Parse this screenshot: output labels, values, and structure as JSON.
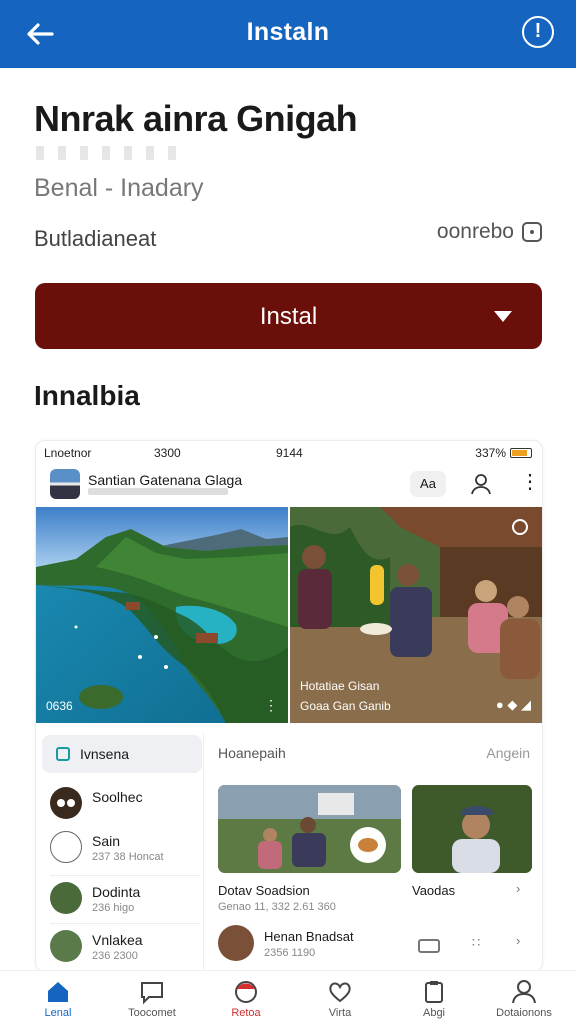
{
  "appbar": {
    "title": "Instaln",
    "back_icon": "back-arrow-icon",
    "info_icon": "info-icon",
    "info_glyph": "!"
  },
  "app": {
    "name": "Nnrak ainra Gnigah",
    "subtitle": "Benal - Inadary",
    "developer": "Butladianeat",
    "size": "oonrebo",
    "install_label": "Instal"
  },
  "section_title": "Innalbia",
  "screenshot": {
    "status": {
      "left": "Lnoetnor",
      "clock": "3300",
      "center": "9144",
      "right": "337%"
    },
    "channel": {
      "name": "Santian Gatenana Glaga",
      "action_label": "Aa"
    },
    "video1": {
      "label": "0636"
    },
    "video2": {
      "title": "Hotatiae Gisan",
      "sub": "Goaa Gan Ganib"
    },
    "sidebar": {
      "tab": "Ivnsena",
      "items": [
        {
          "name": "Soolhec",
          "meta": ""
        },
        {
          "name": "Sain",
          "meta": "237 38 Honcat"
        },
        {
          "name": "Dodinta",
          "meta": "236 higo"
        },
        {
          "name": "Vnlakea",
          "meta": "236 2300"
        }
      ]
    },
    "main": {
      "heading": "Hoanepaih",
      "heading_right": "Angein",
      "tile1_caption": "Dotav Soadsion",
      "tile1_meta": "Genao  11, 332 2.61 360",
      "tile2_caption": "Vaodas",
      "row_title": "Henan Bnadsat",
      "row_meta": "2356 1190"
    }
  },
  "bottom_nav": [
    {
      "label": "Lenal",
      "icon": "home-icon",
      "active": true
    },
    {
      "label": "Toocomet",
      "icon": "chat-icon",
      "active": false
    },
    {
      "label": "Retoa",
      "icon": "record-icon",
      "active": false
    },
    {
      "label": "Virta",
      "icon": "heart-icon",
      "active": false
    },
    {
      "label": "Abgi",
      "icon": "clipboard-icon",
      "active": false
    },
    {
      "label": "Dotaionons",
      "icon": "profile-icon",
      "active": false
    }
  ],
  "colors": {
    "appbar": "#1565c0",
    "install_button": "#6b0f0b",
    "active_nav": "#1565c0",
    "accent_red": "#d32f2f"
  }
}
